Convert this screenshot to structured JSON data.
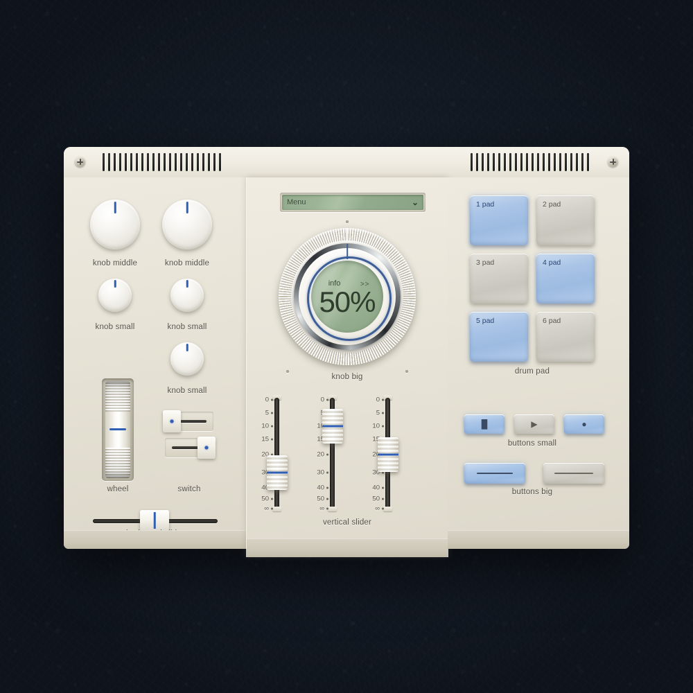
{
  "device": {
    "left_panel": {
      "knobs": [
        {
          "id": "knob-middle-1",
          "label": "knob middle",
          "size": "middle"
        },
        {
          "id": "knob-middle-2",
          "label": "knob middle",
          "size": "middle"
        },
        {
          "id": "knob-small-1",
          "label": "knob small",
          "size": "small"
        },
        {
          "id": "knob-small-2",
          "label": "knob small",
          "size": "small"
        },
        {
          "id": "knob-small-3",
          "label": "knob small",
          "size": "small"
        }
      ],
      "wheel": {
        "label": "wheel"
      },
      "switch": {
        "label": "switch",
        "positions": [
          "left",
          "right"
        ]
      },
      "horizontal_slider": {
        "label": "horizontal slider"
      }
    },
    "center_panel": {
      "menu": {
        "value": "Menu",
        "chevron": "chevron-down-icon",
        "glyph": "⌄"
      },
      "knob_big": {
        "label": "knob big",
        "display": {
          "info": "info",
          "arrows": ">>",
          "value": "50%"
        }
      },
      "vertical_sliders": {
        "label": "vertical slider",
        "scale": [
          "0",
          "5",
          "10",
          "15",
          "20",
          "30",
          "40",
          "50",
          "∞"
        ],
        "values": [
          "30",
          "10",
          "20"
        ]
      }
    },
    "right_panel": {
      "drum_pad": {
        "label": "drum pad",
        "pads": [
          {
            "label": "1 pad",
            "active": true
          },
          {
            "label": "2 pad",
            "active": false
          },
          {
            "label": "3 pad",
            "active": false
          },
          {
            "label": "4 pad",
            "active": true
          },
          {
            "label": "5 pad",
            "active": true
          },
          {
            "label": "6 pad",
            "active": false
          }
        ]
      },
      "buttons_small": {
        "label": "buttons small",
        "items": [
          {
            "icon": "pause-icon",
            "glyph": "▐▌",
            "active": true
          },
          {
            "icon": "play-icon",
            "glyph": "▶",
            "active": false
          },
          {
            "icon": "record-icon",
            "glyph": "●",
            "active": true
          }
        ]
      },
      "buttons_big": {
        "label": "buttons big",
        "items": [
          {
            "icon": "dash-icon",
            "active": true
          },
          {
            "icon": "dash-icon",
            "active": false
          }
        ]
      }
    },
    "colors": {
      "accent_blue": "#2f5fb4",
      "pad_active": "#a9c4e6",
      "lcd_green": "#9ab293",
      "shell": "#eae6da",
      "backdrop": "#161c26"
    }
  }
}
